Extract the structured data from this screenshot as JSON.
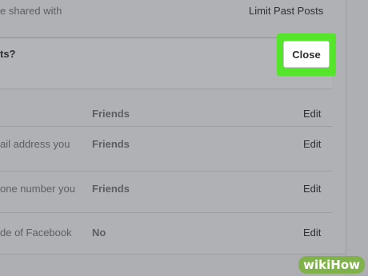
{
  "top_row": {
    "label": "e shared with",
    "action": "Limit Past Posts"
  },
  "question": {
    "label": "ts?"
  },
  "close_button": {
    "label": "Close",
    "highlight_color": "#55e52a"
  },
  "rows": [
    {
      "label": "",
      "value": "Friends",
      "action": "Edit"
    },
    {
      "label": "ail address you",
      "value": "Friends",
      "action": "Edit"
    },
    {
      "label": "one number you",
      "value": "Friends",
      "action": "Edit"
    },
    {
      "label": "de of Facebook",
      "value": "No",
      "action": "Edit"
    }
  ],
  "watermark": {
    "wiki": "wiki",
    "how": "How"
  }
}
